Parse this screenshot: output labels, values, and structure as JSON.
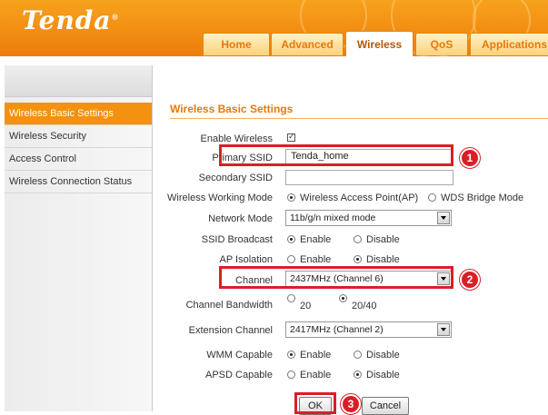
{
  "header": {
    "logo": "Tenda",
    "tabs": [
      "Home",
      "Advanced",
      "Wireless",
      "QoS",
      "Applications"
    ],
    "active_tab": "Wireless"
  },
  "sidebar": {
    "items": [
      {
        "label": "Wireless Basic Settings",
        "active": true
      },
      {
        "label": "Wireless Security",
        "active": false
      },
      {
        "label": "Access Control",
        "active": false
      },
      {
        "label": "Wireless Connection Status",
        "active": false
      }
    ]
  },
  "form": {
    "title": "Wireless Basic Settings",
    "enable_wireless": {
      "label": "Enable Wireless",
      "checked": true
    },
    "primary_ssid": {
      "label": "Primary SSID",
      "value": "Tenda_home"
    },
    "secondary_ssid": {
      "label": "Secondary SSID",
      "value": ""
    },
    "working_mode": {
      "label": "Wireless Working Mode",
      "options": [
        "Wireless Access Point(AP)",
        "WDS Bridge Mode"
      ],
      "selected": 0
    },
    "network_mode": {
      "label": "Network Mode",
      "value": "11b/g/n mixed mode"
    },
    "ssid_broadcast": {
      "label": "SSID Broadcast",
      "options": [
        "Enable",
        "Disable"
      ],
      "selected": 0
    },
    "ap_isolation": {
      "label": "AP Isolation",
      "options": [
        "Enable",
        "Disable"
      ],
      "selected": 1
    },
    "channel": {
      "label": "Channel",
      "value": "2437MHz (Channel 6)"
    },
    "channel_bandwidth": {
      "label": "Channel Bandwidth",
      "options": [
        "20",
        "20/40"
      ],
      "selected": 1
    },
    "extension_channel": {
      "label": "Extension Channel",
      "value": "2417MHz (Channel 2)"
    },
    "wmm_capable": {
      "label": "WMM Capable",
      "options": [
        "Enable",
        "Disable"
      ],
      "selected": 0
    },
    "apsd_capable": {
      "label": "APSD Capable",
      "options": [
        "Enable",
        "Disable"
      ],
      "selected": 1
    },
    "ok_label": "OK",
    "cancel_label": "Cancel"
  },
  "annotations": [
    "1",
    "2",
    "3"
  ],
  "colors": {
    "brand_orange": "#f39110",
    "highlight_red": "#d91f26",
    "title_orange": "#e8780b"
  }
}
